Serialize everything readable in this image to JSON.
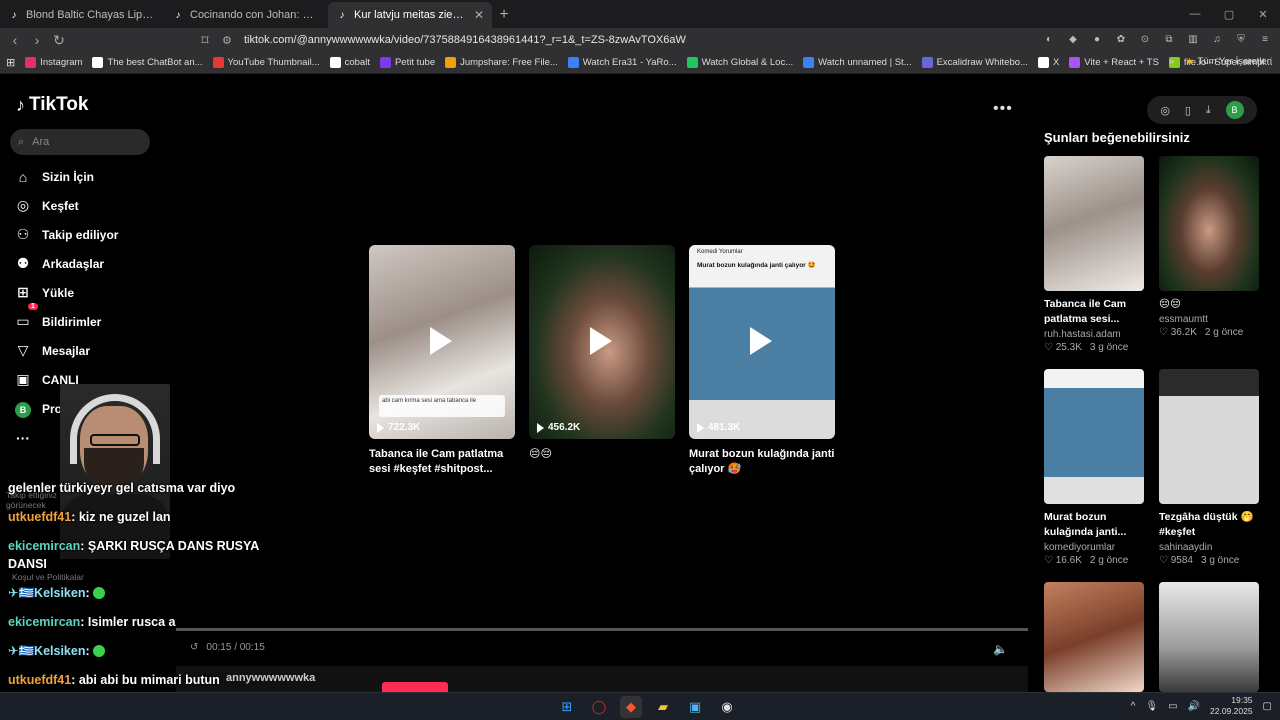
{
  "tabs": [
    {
      "title": "Blond Baltic Chayas Lip Sync Glamour",
      "active": false
    },
    {
      "title": "Cocinando con Johan: Recetas para",
      "active": false
    },
    {
      "title": "Kur latvju meitas zied #pex #pex",
      "active": true
    }
  ],
  "address": {
    "url": "tiktok.com/@annywwwwwwka/video/7375884916438961441?_r=1&_t=ZS-8zwAvTOX6aW"
  },
  "bookmarks": [
    {
      "label": "Instagram",
      "color": "#e1306c"
    },
    {
      "label": "The best ChatBot an...",
      "color": "#ffffff"
    },
    {
      "label": "YouTube Thumbnail...",
      "color": "#e53935"
    },
    {
      "label": "cobalt",
      "color": "#ffffff"
    },
    {
      "label": "Petit tube",
      "color": "#7c3aed"
    },
    {
      "label": "Jumpshare: Free File...",
      "color": "#f59e0b"
    },
    {
      "label": "Watch Era31 - YaRo...",
      "color": "#3b82f6"
    },
    {
      "label": "Watch Global & Loc...",
      "color": "#22c55e"
    },
    {
      "label": "Watch unnamed | St...",
      "color": "#3b82f6"
    },
    {
      "label": "Excalidraw Whitebo...",
      "color": "#6965db"
    },
    {
      "label": "X",
      "color": "#ffffff"
    },
    {
      "label": "Vite + React + TS",
      "color": "#a855f7"
    },
    {
      "label": "file.io - Super simpl...",
      "color": "#84cc16"
    }
  ],
  "bookmarks_folder": "Tüm Yer İşaretleri",
  "tiktok": {
    "logo": "TikTok",
    "search_placeholder": "Ara",
    "nav": [
      {
        "label": "Sizin İçin",
        "icon": "home-icon",
        "glyph": "⌂"
      },
      {
        "label": "Keşfet",
        "icon": "compass-icon",
        "glyph": "◎"
      },
      {
        "label": "Takip ediliyor",
        "icon": "user-follow-icon",
        "glyph": "⚇"
      },
      {
        "label": "Arkadaşlar",
        "icon": "friends-icon",
        "glyph": "⚉"
      },
      {
        "label": "Yükle",
        "icon": "upload-icon",
        "glyph": "⊞"
      },
      {
        "label": "Bildirimler",
        "icon": "inbox-icon",
        "glyph": "▭"
      },
      {
        "label": "Mesajlar",
        "icon": "message-icon",
        "glyph": "▽"
      },
      {
        "label": "CANLI",
        "icon": "live-icon",
        "glyph": "▣"
      },
      {
        "label": "Profil",
        "icon": "profile-icon",
        "glyph": "B"
      },
      {
        "label": "Diğer",
        "icon": "more-icon",
        "glyph": "···"
      }
    ],
    "notifications_badge": "1",
    "avatar_letter": "B",
    "videos": [
      {
        "views": "722.3K",
        "title": "Tabanca ile Cam patlatma sesi #keşfet #shitpost...",
        "overlay": "abi cam kırma sesi ama tabanca ile"
      },
      {
        "views": "456.2K",
        "title": "😔😔",
        "overlay": ""
      },
      {
        "views": "481.3K",
        "title": "Murat bozun kulağında janti çalıyor 🥵",
        "overlay": "Murat bozun kulağında janti çalıyor 🤩"
      }
    ],
    "video3_header": "Komedi Yorumlar",
    "recommend_title": "Şunları beğenebilirsiniz",
    "recommendations": [
      {
        "title": "Tabanca ile Cam patlatma sesi...",
        "user": "ruh.hastasi.adam",
        "likes": "25.3K",
        "ago": "3 g önce"
      },
      {
        "title": "😔😔",
        "user": "essmaumtt",
        "likes": "36.2K",
        "ago": "2 g önce"
      },
      {
        "title": "Murat bozun kulağında janti...",
        "user": "komediyorumlar",
        "likes": "16.6K",
        "ago": "2 g önce"
      },
      {
        "title": "Tezgâha düştük 🤭 #keşfet",
        "user": "sahinaaydin",
        "likes": "9584",
        "ago": "3 g önce"
      }
    ],
    "player_time": "00:15 / 00:15",
    "bottom_user": "annywwwwwwka",
    "ghost_following": "Takip ettiğiniz hesaplar burada görünecek",
    "ghost_policy": "Koşul ve Politikalar"
  },
  "chat": [
    {
      "user": "",
      "text": "gelenler türkiyeyr gel catısma var diyo",
      "color": "#ffffff"
    },
    {
      "user": "utkuefdf41",
      "text": "kiz ne guzel lan",
      "color": "#f0a23b"
    },
    {
      "user": "ekicemircan",
      "text": "ŞARKI RUSÇA DANS RUSYA DANSI",
      "color": "#5fd3c2"
    },
    {
      "user": "✈🇬🇷Kelsiken",
      "text": "",
      "color": "#8fe0f5",
      "emote": true
    },
    {
      "user": "ekicemircan",
      "text": "Isimler rusca a",
      "color": "#5fd3c2"
    },
    {
      "user": "✈🇬🇷Kelsiken",
      "text": "",
      "color": "#8fe0f5",
      "emote": true
    },
    {
      "user": "utkuefdf41",
      "text": "abi abi bu mimari butun slavlarda var",
      "color": "#f0a23b"
    }
  ],
  "clock": {
    "time": "19:35",
    "date": "22.09.2025"
  },
  "colors": {
    "accent": "#fe2c55",
    "avatar": "#2e9c4a"
  }
}
